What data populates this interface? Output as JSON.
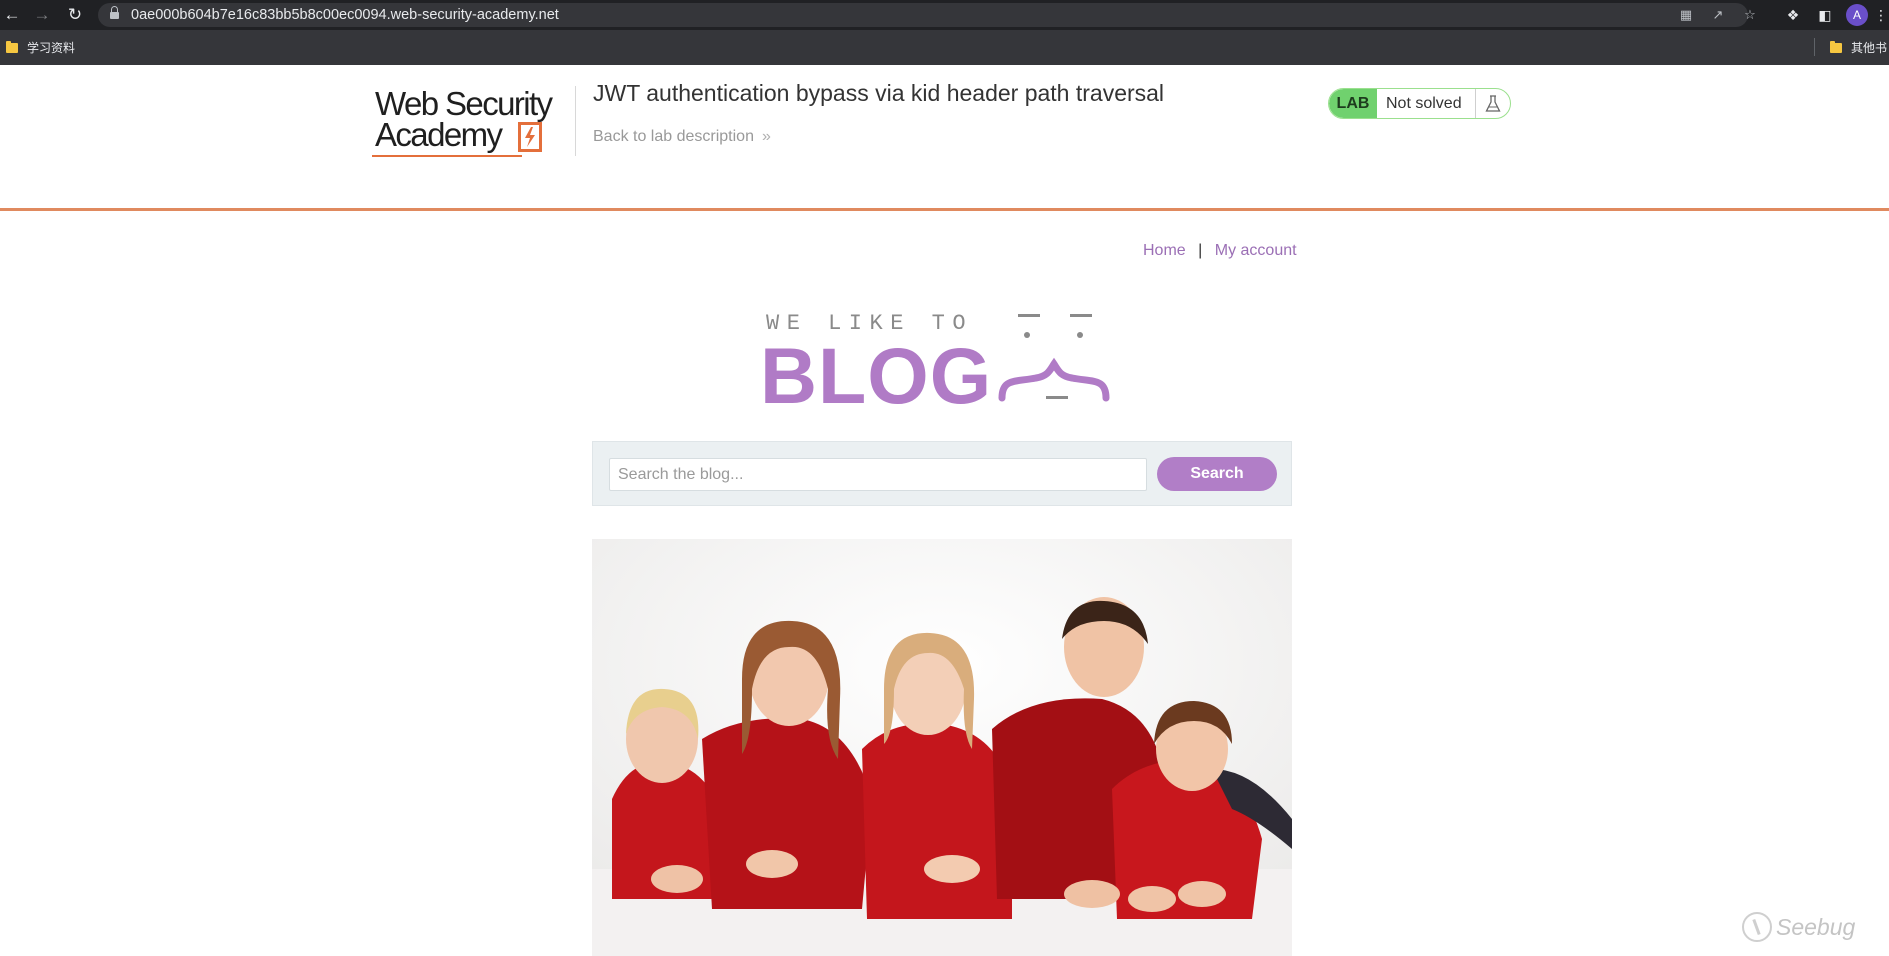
{
  "browser": {
    "url": "0ae000b604b7e16c83bb5b8c00ec0094.web-security-academy.net",
    "back_icon": "arrow-left-icon",
    "forward_icon": "arrow-right-icon",
    "reload_icon": "reload-icon",
    "avatar_initial": "A",
    "bookmarks": [
      {
        "label": "学习资料"
      },
      {
        "label": "其他书"
      }
    ]
  },
  "lab": {
    "logo_line1": "Web Security",
    "logo_line2": "Academy",
    "title": "JWT authentication bypass via kid header path traversal",
    "back_link": "Back to lab description",
    "badge": "LAB",
    "status": "Not solved",
    "colors": {
      "accent": "#e46f3b",
      "badge": "#70d16e"
    }
  },
  "nav": {
    "home": "Home",
    "separator": "|",
    "account": "My account"
  },
  "blog_logo": {
    "tagline": "WE LIKE TO",
    "word": "BLOG"
  },
  "search": {
    "placeholder": "Search the blog...",
    "button": "Search"
  },
  "watermark": "Seebug",
  "colors": {
    "link": "#9b6fb5",
    "brand_purple": "#b07bc6"
  }
}
